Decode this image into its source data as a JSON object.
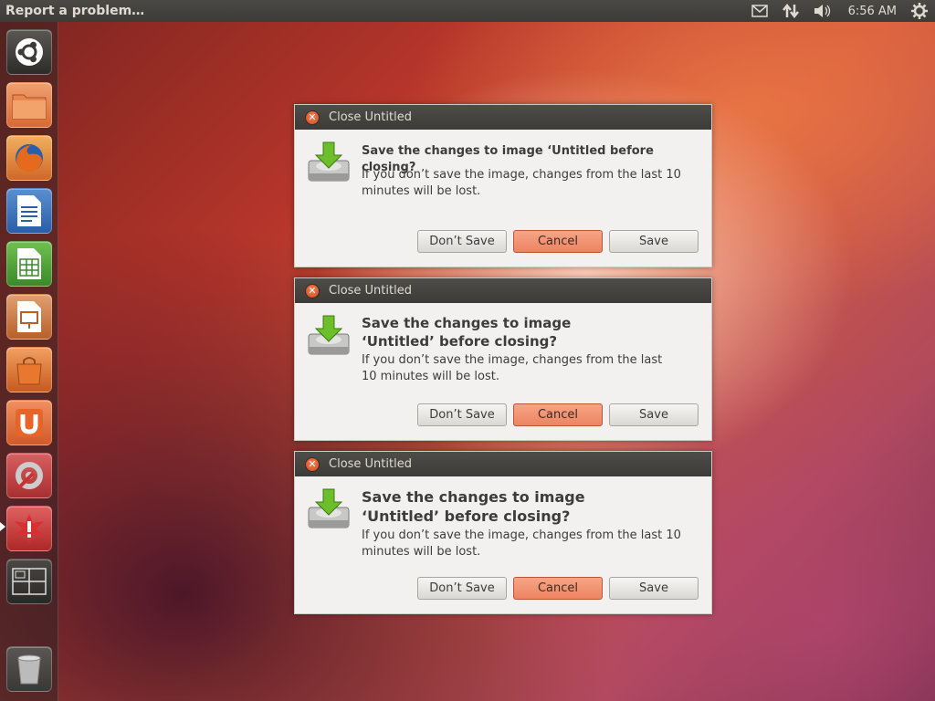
{
  "top_panel": {
    "title": "Report a problem…",
    "clock": "6:56 AM",
    "indicators": [
      "mail-icon",
      "network-icon",
      "volume-icon",
      "session-gear-icon"
    ]
  },
  "launcher": {
    "items": [
      {
        "name": "dash-home",
        "icon": "ubuntu-logo-icon"
      },
      {
        "name": "files",
        "icon": "folder-icon"
      },
      {
        "name": "firefox",
        "icon": "firefox-icon"
      },
      {
        "name": "libreoffice-writer",
        "icon": "writer-icon"
      },
      {
        "name": "libreoffice-calc",
        "icon": "calc-icon"
      },
      {
        "name": "libreoffice-impress",
        "icon": "impress-icon"
      },
      {
        "name": "software-center",
        "icon": "shopping-bag-icon"
      },
      {
        "name": "ubuntu-one",
        "icon": "ubuntu-one-icon"
      },
      {
        "name": "system-settings",
        "icon": "settings-wrench-icon"
      },
      {
        "name": "problem-report",
        "icon": "crash-report-icon"
      },
      {
        "name": "workspace-switcher",
        "icon": "workspaces-icon"
      },
      {
        "name": "trash",
        "icon": "trash-icon"
      }
    ]
  },
  "dialogs": [
    {
      "title": "Close Untitled",
      "primary": "Save the changes to image ‘Untitled before closing?",
      "secondary": "If you don’t save the image, changes from the last 10 minutes will be lost.",
      "buttons": {
        "dont_save": "Don’t Save",
        "cancel": "Cancel",
        "save": "Save"
      }
    },
    {
      "title": "Close Untitled",
      "primary": "Save the changes to image ‘Untitled’ before closing?",
      "secondary": "If you don’t save the image, changes from the last 10 minutes will be lost.",
      "buttons": {
        "dont_save": "Don’t Save",
        "cancel": "Cancel",
        "save": "Save"
      }
    },
    {
      "title": "Close Untitled",
      "primary": "Save the changes to image ‘Untitled’ before closing?",
      "secondary": "If you don’t save the image, changes from the last 10 minutes will be lost.",
      "buttons": {
        "dont_save": "Don’t Save",
        "cancel": "Cancel",
        "save": "Save"
      }
    }
  ],
  "colors": {
    "panel": "#3c3b37",
    "accent": "#ec8460",
    "dialog_bg": "#f2f1f0"
  }
}
